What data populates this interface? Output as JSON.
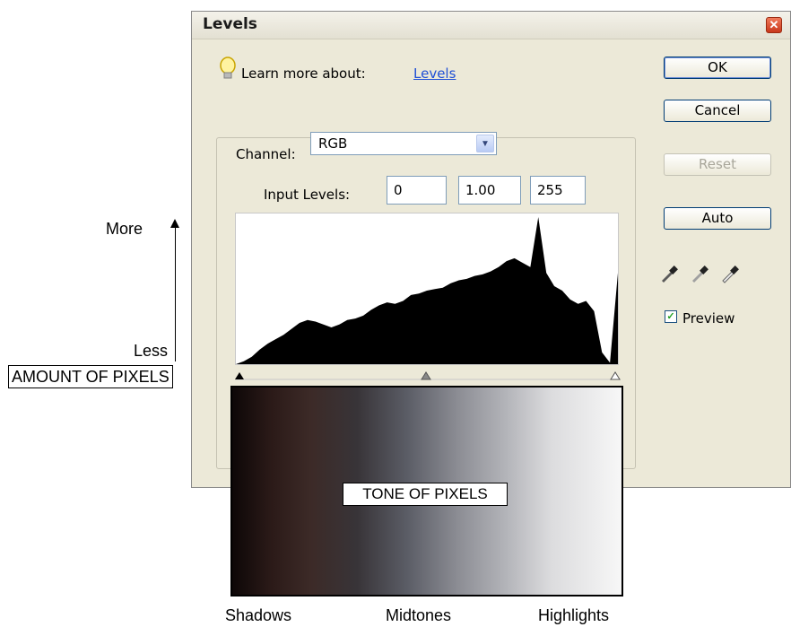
{
  "dialog": {
    "title": "Levels",
    "learn_more_label": "Learn more about:",
    "learn_more_link": "Levels",
    "channel_label": "Channel:",
    "channel_value": "RGB",
    "input_levels_label": "Input Levels:",
    "input_levels": {
      "black": "0",
      "gamma": "1.00",
      "white": "255"
    },
    "buttons": {
      "ok": "OK",
      "cancel": "Cancel",
      "reset": "Reset",
      "auto": "Auto"
    },
    "preview_label": "Preview",
    "preview_checked": true,
    "icons": [
      "lightbulb-icon",
      "close-icon",
      "dropdown-arrow-icon",
      "black-eyedropper-icon",
      "gray-eyedropper-icon",
      "white-eyedropper-icon"
    ],
    "histogram_levels": [
      0.0,
      0.02,
      0.05,
      0.1,
      0.14,
      0.17,
      0.2,
      0.24,
      0.28,
      0.3,
      0.29,
      0.27,
      0.25,
      0.27,
      0.3,
      0.31,
      0.33,
      0.37,
      0.4,
      0.42,
      0.41,
      0.43,
      0.47,
      0.48,
      0.5,
      0.51,
      0.52,
      0.55,
      0.57,
      0.58,
      0.6,
      0.61,
      0.63,
      0.66,
      0.7,
      0.72,
      0.69,
      0.66,
      1.0,
      0.62,
      0.53,
      0.5,
      0.44,
      0.41,
      0.43,
      0.36,
      0.08,
      0.01,
      0.62
    ]
  },
  "annotations": {
    "more": "More",
    "less": "Less",
    "amount": "AMOUNT OF PIXELS",
    "tone": "TONE OF PIXELS",
    "shadows": "Shadows",
    "midtones": "Midtones",
    "highlights": "Highlights"
  }
}
